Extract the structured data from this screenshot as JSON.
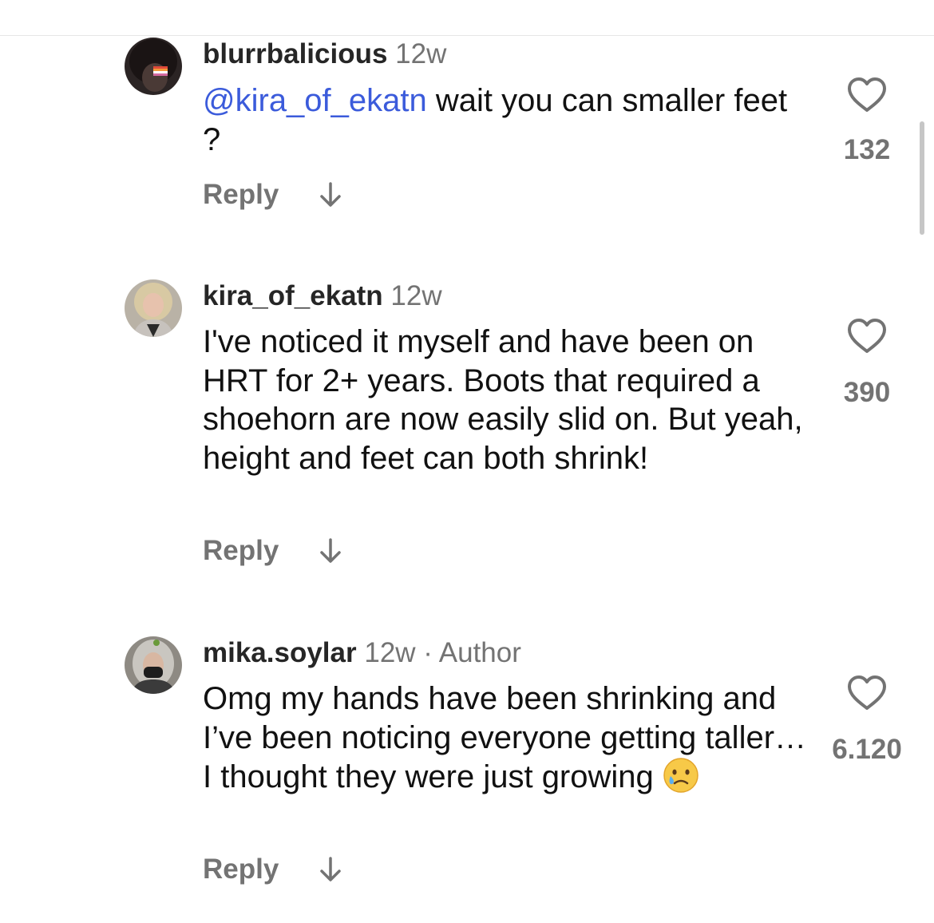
{
  "comments": [
    {
      "username": "blurrbalicious",
      "time": "12w",
      "mention": "@kira_of_ekatn",
      "text": " wait you can smaller feet ?",
      "reply_label": "Reply",
      "likes": "132",
      "avatar_icon": "avatar-dark-hair-pride-flag"
    },
    {
      "username": "kira_of_ekatn",
      "time": "12w",
      "text": "I've noticed it myself and have been on HRT for 2+ years.  Boots that required a shoehorn are now easily slid on.  But yeah, height and feet can both shrink!",
      "reply_label": "Reply",
      "likes": "390",
      "avatar_icon": "avatar-blonde-person"
    },
    {
      "username": "mika.soylar",
      "time": "12w",
      "separator": " · ",
      "badge": "Author",
      "text": "Omg my hands have been shrinking and I’ve been noticing everyone getting taller… I thought they were just growing",
      "emoji": "sad-tear-emoji",
      "reply_label": "Reply",
      "likes": "6.120",
      "avatar_icon": "avatar-grey-hair-mask"
    }
  ],
  "colors": {
    "mention": "#3b5bdb",
    "muted": "#737373",
    "text": "#111111"
  }
}
